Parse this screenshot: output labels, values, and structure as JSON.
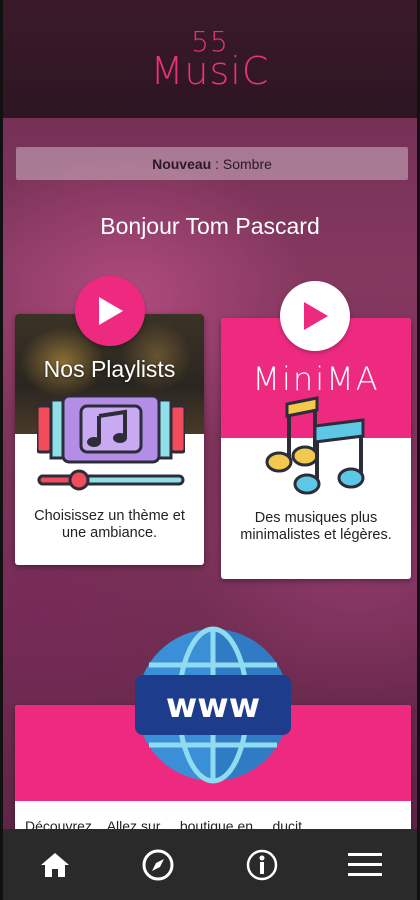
{
  "app": {
    "logo_number": "55",
    "logo_word": "MusiC"
  },
  "news": {
    "label": "Nouveau",
    "separator": " : ",
    "value": "Sombre"
  },
  "greeting": "Bonjour Tom Pascard",
  "cards": {
    "playlists": {
      "title": "Nos Playlists",
      "description": "Choisissez un thème et une ambiance.",
      "icon": "music-player-icon",
      "play_icon": "play-icon"
    },
    "minima": {
      "title": "MiniMA",
      "description": "Des musiques plus minimalistes et légères.",
      "icon": "music-notes-icon",
      "play_icon": "play-icon"
    },
    "web": {
      "icon": "www-globe-icon",
      "description": "Découvrez... Allez sur ... boutique en ... ducit"
    }
  },
  "navbar": {
    "items": [
      {
        "name": "home",
        "icon": "home-icon"
      },
      {
        "name": "explore",
        "icon": "compass-icon"
      },
      {
        "name": "info",
        "icon": "info-icon"
      },
      {
        "name": "menu",
        "icon": "hamburger-menu-icon"
      }
    ]
  },
  "colors": {
    "brand_pink": "#ee2a80",
    "logo_pink": "#e8327e",
    "background_plum": "#7a3158",
    "navbar": "#2a2a2a"
  }
}
